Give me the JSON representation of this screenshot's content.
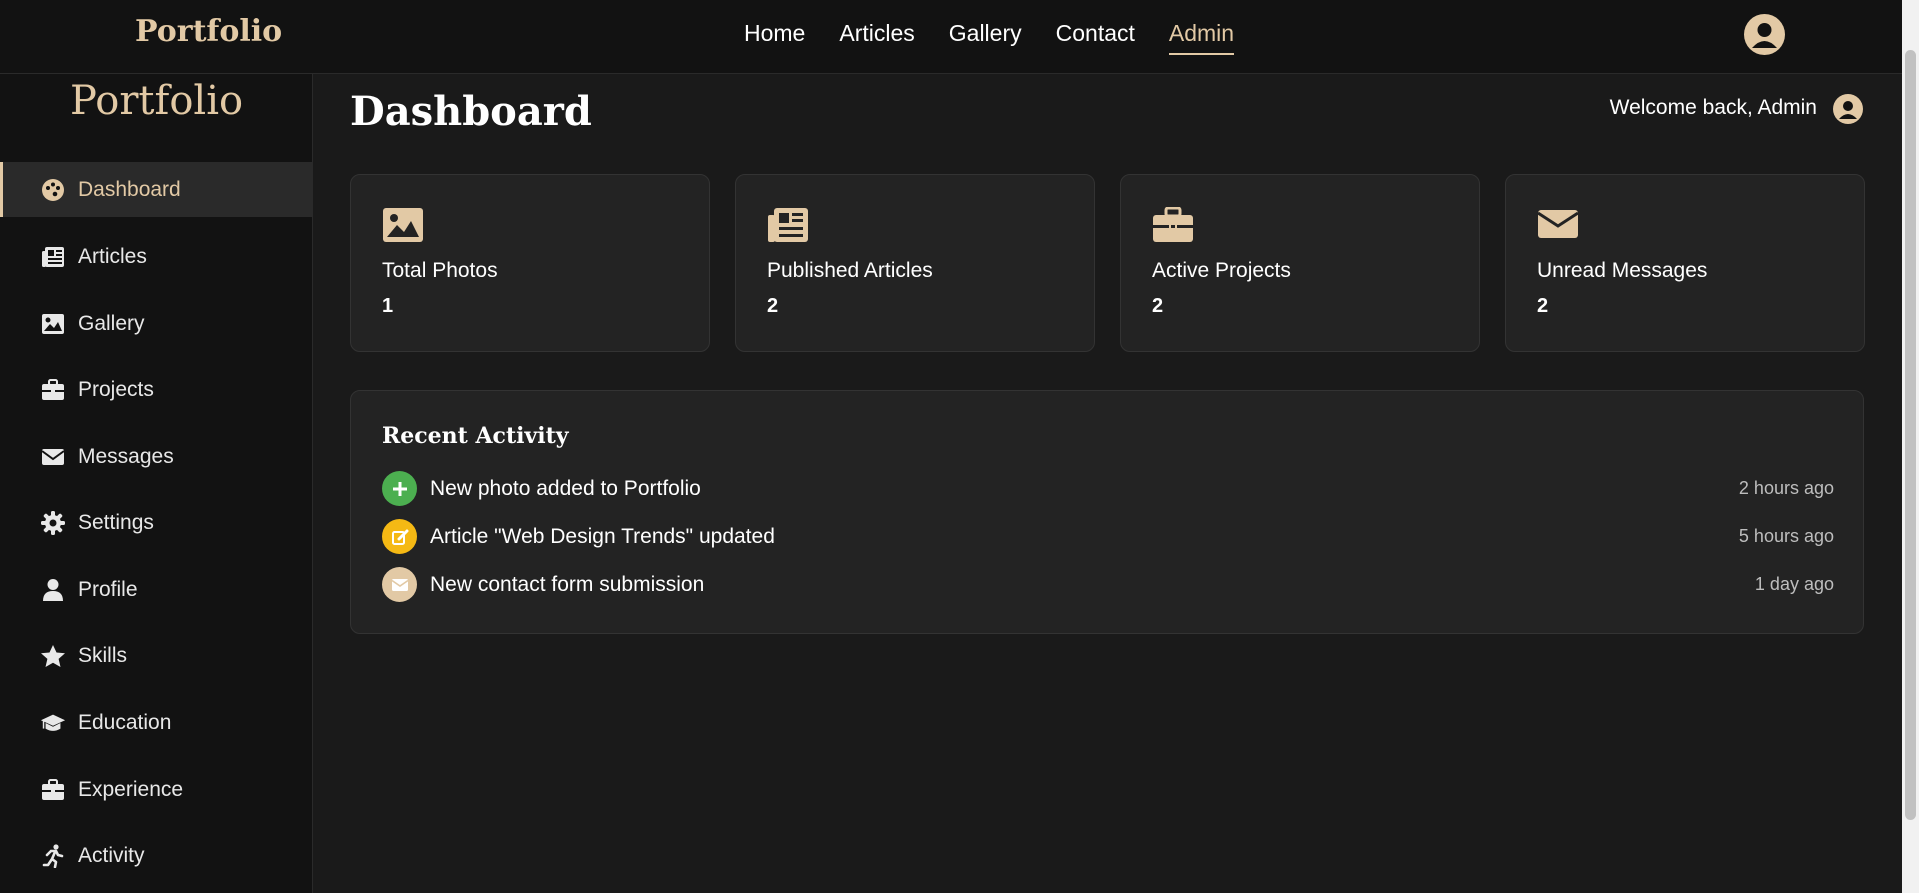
{
  "nav": {
    "brand": "Portfolio",
    "links": [
      "Home",
      "Articles",
      "Gallery",
      "Contact",
      "Admin"
    ],
    "active": "Admin"
  },
  "sidebar": {
    "title": "Portfolio",
    "items": [
      {
        "label": "Dashboard",
        "icon": "palette-icon"
      },
      {
        "label": "Articles",
        "icon": "newspaper-icon"
      },
      {
        "label": "Gallery",
        "icon": "image-icon"
      },
      {
        "label": "Projects",
        "icon": "briefcase-icon"
      },
      {
        "label": "Messages",
        "icon": "envelope-icon"
      },
      {
        "label": "Settings",
        "icon": "gear-icon"
      },
      {
        "label": "Profile",
        "icon": "user-icon"
      },
      {
        "label": "Skills",
        "icon": "star-icon"
      },
      {
        "label": "Education",
        "icon": "graduation-cap-icon"
      },
      {
        "label": "Experience",
        "icon": "briefcase-icon"
      },
      {
        "label": "Activity",
        "icon": "running-icon"
      }
    ],
    "active": "Dashboard"
  },
  "main": {
    "title": "Dashboard",
    "welcome": "Welcome back, Admin",
    "cards": [
      {
        "label": "Total Photos",
        "value": "1",
        "icon": "image-icon"
      },
      {
        "label": "Published Articles",
        "value": "2",
        "icon": "newspaper-icon"
      },
      {
        "label": "Active Projects",
        "value": "2",
        "icon": "briefcase-icon"
      },
      {
        "label": "Unread Messages",
        "value": "2",
        "icon": "envelope-icon"
      }
    ],
    "activity": {
      "title": "Recent Activity",
      "items": [
        {
          "text": "New photo added to Portfolio",
          "time": "2 hours ago",
          "icon": "plus-icon",
          "color": "#4caf50"
        },
        {
          "text": "Article \"Web Design Trends\" updated",
          "time": "5 hours ago",
          "icon": "edit-icon",
          "color": "#f5b914"
        },
        {
          "text": "New contact form submission",
          "time": "1 day ago",
          "icon": "envelope-icon",
          "color": "#e2c9a5"
        }
      ]
    }
  },
  "colors": {
    "accent": "#e2c9a5",
    "background": "#1a1a1a",
    "panel": "#232323"
  }
}
